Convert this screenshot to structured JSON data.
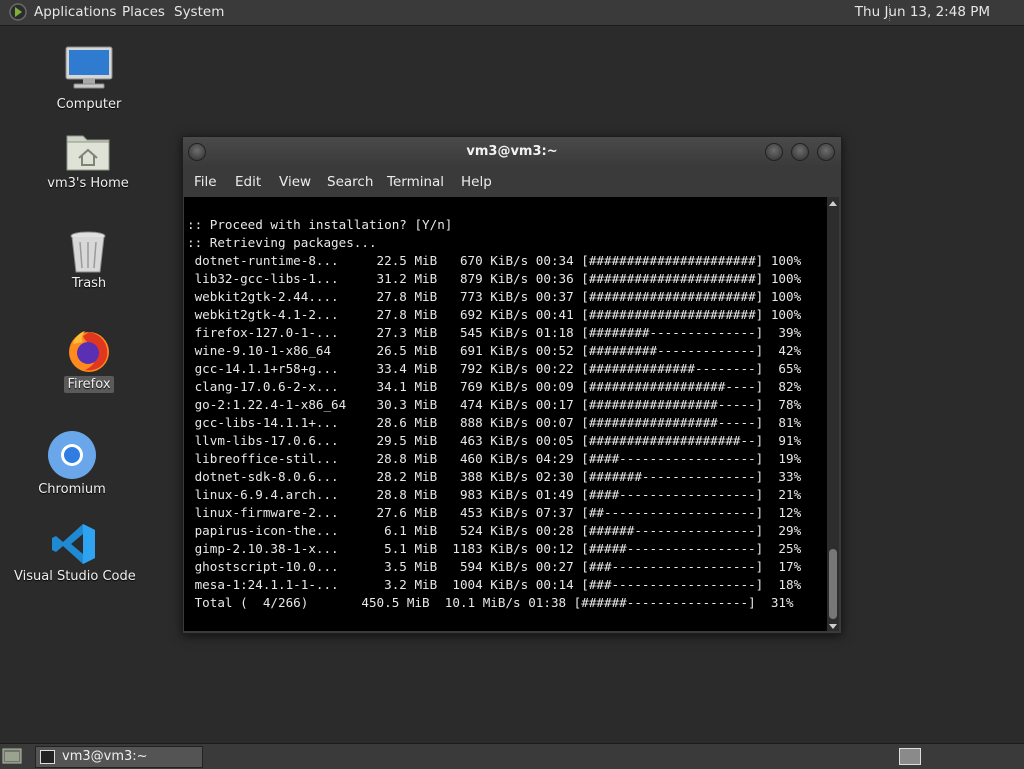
{
  "top_panel": {
    "menus": [
      "Applications",
      "Places",
      "System"
    ],
    "clock": "Thu Jun 13,  2:48 PM"
  },
  "desktop_icons": [
    {
      "label": "Computer",
      "icon": "computer-icon"
    },
    {
      "label": "vm3's Home",
      "icon": "home-folder-icon"
    },
    {
      "label": "Trash",
      "icon": "trash-icon"
    },
    {
      "label": "Firefox",
      "icon": "firefox-icon",
      "selected": true
    },
    {
      "label": "Chromium",
      "icon": "chromium-icon"
    },
    {
      "label": "Visual Studio Code",
      "icon": "vscode-icon"
    }
  ],
  "window": {
    "title": "vm3@vm3:~",
    "menu": [
      "File",
      "Edit",
      "View",
      "Search",
      "Terminal",
      "Help"
    ]
  },
  "terminal": {
    "lines": [
      ":: Proceed with installation? [Y/n]",
      ":: Retrieving packages...",
      " dotnet-runtime-8...     22.5 MiB   670 KiB/s 00:34 [######################] 100%",
      " lib32-gcc-libs-1...     31.2 MiB   879 KiB/s 00:36 [######################] 100%",
      " webkit2gtk-2.44....     27.8 MiB   773 KiB/s 00:37 [######################] 100%",
      " webkit2gtk-4.1-2...     27.8 MiB   692 KiB/s 00:41 [######################] 100%",
      " firefox-127.0-1-...     27.3 MiB   545 KiB/s 01:18 [########--------------]  39%",
      " wine-9.10-1-x86_64      26.5 MiB   691 KiB/s 00:52 [#########-------------]  42%",
      " gcc-14.1.1+r58+g...     33.4 MiB   792 KiB/s 00:22 [##############--------]  65%",
      " clang-17.0.6-2-x...     34.1 MiB   769 KiB/s 00:09 [##################----]  82%",
      " go-2:1.22.4-1-x86_64    30.3 MiB   474 KiB/s 00:17 [#################-----]  78%",
      " gcc-libs-14.1.1+...     28.6 MiB   888 KiB/s 00:07 [#################-----]  81%",
      " llvm-libs-17.0.6...     29.5 MiB   463 KiB/s 00:05 [####################--]  91%",
      " libreoffice-stil...     28.8 MiB   460 KiB/s 04:29 [####------------------]  19%",
      " dotnet-sdk-8.0.6...     28.2 MiB   388 KiB/s 02:30 [#######---------------]  33%",
      " linux-6.9.4.arch...     28.8 MiB   983 KiB/s 01:49 [####------------------]  21%",
      " linux-firmware-2...     27.6 MiB   453 KiB/s 07:37 [##--------------------]  12%",
      " papirus-icon-the...      6.1 MiB   524 KiB/s 00:28 [######----------------]  29%",
      " gimp-2.10.38-1-x...      5.1 MiB  1183 KiB/s 00:12 [#####-----------------]  25%",
      " ghostscript-10.0...      3.5 MiB   594 KiB/s 00:27 [###-------------------]  17%",
      " mesa-1:24.1.1-1-...      3.2 MiB  1004 KiB/s 00:14 [###-------------------]  18%",
      " Total (  4/266)       450.5 MiB  10.1 MiB/s 01:38 [######----------------]  31%"
    ]
  },
  "bottom_panel": {
    "task_label": "vm3@vm3:~"
  }
}
